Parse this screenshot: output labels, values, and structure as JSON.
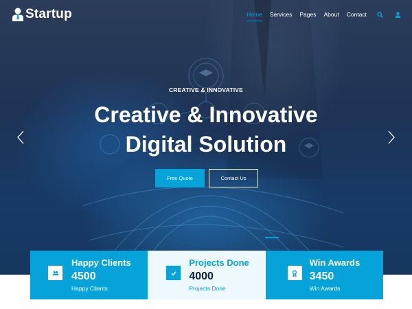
{
  "brand": {
    "name": "Startup",
    "icon": "user-tie-icon"
  },
  "nav": {
    "items": [
      {
        "label": "Home",
        "active": true
      },
      {
        "label": "Services",
        "active": false
      },
      {
        "label": "Pages",
        "active": false
      },
      {
        "label": "About",
        "active": false
      },
      {
        "label": "Contact",
        "active": false
      }
    ],
    "search_icon": "search-icon",
    "user_icon": "user-icon"
  },
  "hero": {
    "subtitle": "CREATIVE & INNOVATIVE",
    "title_line1": "Creative & Innovative",
    "title_line2": "Digital Solution",
    "primary_button": "Free Quote",
    "secondary_button": "Contact Us",
    "prev_icon": "chevron-left-icon",
    "next_icon": "chevron-right-icon"
  },
  "stats": [
    {
      "title": "Happy Clients",
      "value": "4500",
      "label": "Happy Clients",
      "icon": "users-icon"
    },
    {
      "title": "Projects Done",
      "value": "4000",
      "label": "Projects Done",
      "icon": "check-icon"
    },
    {
      "title": "Win Awards",
      "value": "3450",
      "label": "Win Awards",
      "icon": "award-icon"
    }
  ],
  "colors": {
    "accent": "#06a3da",
    "dark": "#0b1b3d",
    "light_bg": "#eef9fe"
  }
}
